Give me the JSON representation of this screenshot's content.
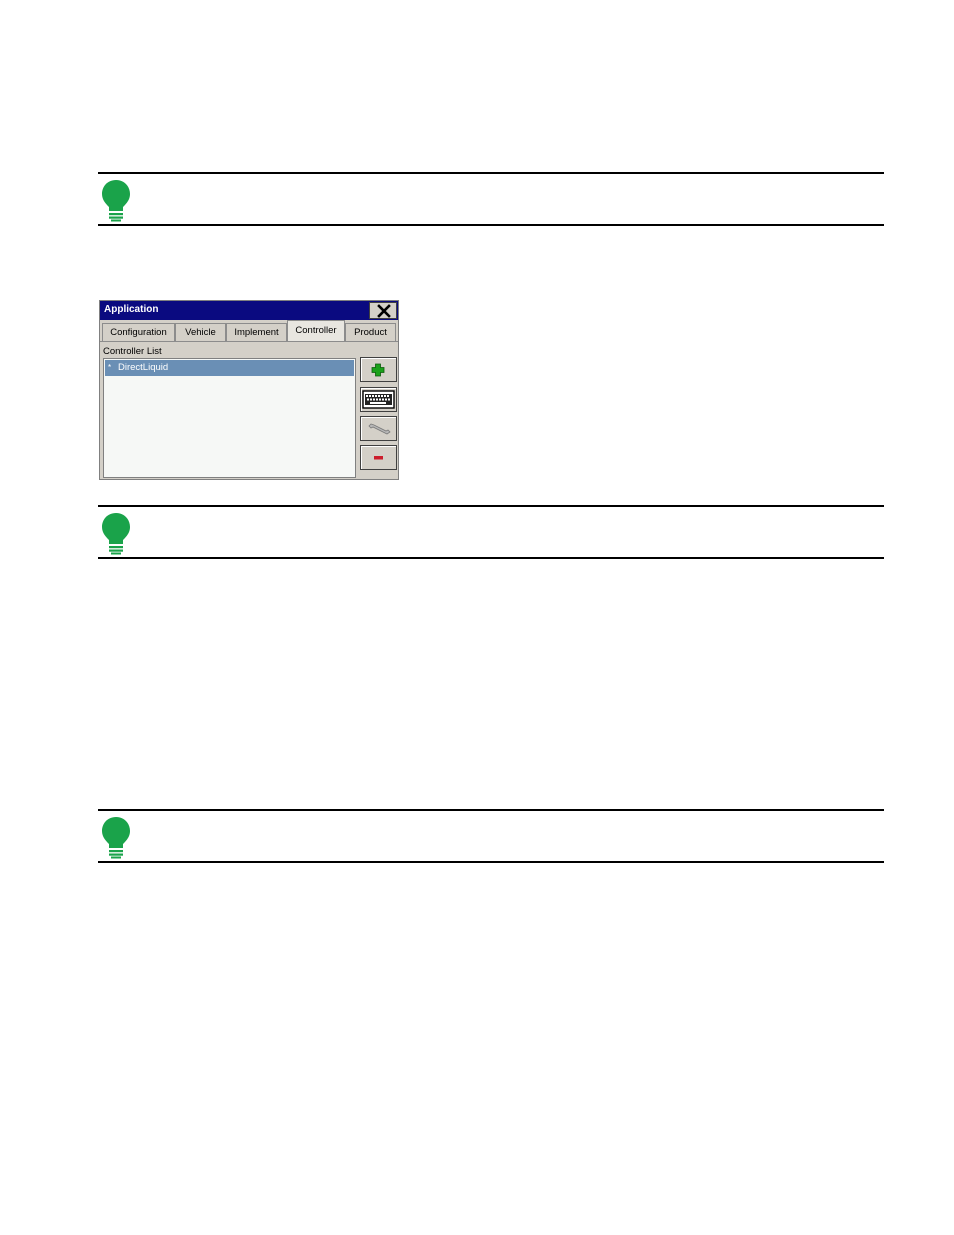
{
  "dialog": {
    "title": "Application",
    "tabs": [
      {
        "label": "Configuration",
        "active": false
      },
      {
        "label": "Vehicle",
        "active": false
      },
      {
        "label": "Implement",
        "active": false
      },
      {
        "label": "Controller",
        "active": true
      },
      {
        "label": "Product",
        "active": false
      }
    ],
    "list_label": "Controller List",
    "items": [
      {
        "label": "DirectLiquid",
        "selected": true,
        "marker": "*"
      }
    ],
    "buttons": [
      "plus-icon",
      "keyboard-icon",
      "wrench-icon",
      "minus-icon"
    ]
  },
  "colors": {
    "title_bar": "#0a0a80",
    "selection": "#6a8fb5",
    "bulb": "#1aa34a",
    "add": "#1aa11a",
    "remove": "#cc1d2c"
  }
}
